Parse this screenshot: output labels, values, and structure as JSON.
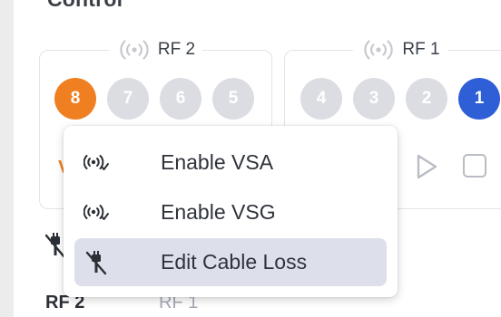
{
  "section": {
    "title": "Control"
  },
  "rf_groups": [
    {
      "title": "RF 2",
      "icon": "wireless-signal-icon",
      "ports": [
        {
          "label": "8",
          "state": "active",
          "color": "#f07f22"
        },
        {
          "label": "7",
          "state": "inactive"
        },
        {
          "label": "6",
          "state": "inactive"
        },
        {
          "label": "5",
          "state": "inactive"
        }
      ],
      "mode_label": "VS"
    },
    {
      "title": "RF 1",
      "icon": "wireless-signal-icon",
      "ports": [
        {
          "label": "4",
          "state": "inactive"
        },
        {
          "label": "3",
          "state": "inactive"
        },
        {
          "label": "2",
          "state": "inactive"
        },
        {
          "label": "1",
          "state": "active",
          "color": "#2f5fd6"
        }
      ]
    }
  ],
  "context_menu": {
    "items": [
      {
        "label": "Enable VSA",
        "icon": "wireless-signal-icon",
        "highlighted": false
      },
      {
        "label": "Enable VSG",
        "icon": "wireless-signal-icon",
        "highlighted": false
      },
      {
        "label": "Edit Cable Loss",
        "icon": "cable-off-icon",
        "highlighted": true
      }
    ]
  },
  "bottom": {
    "rf2_label": "RF 2",
    "rf1_label": "RF 1"
  },
  "colors": {
    "accent_orange": "#f07f22",
    "accent_blue": "#2f5fd6",
    "menu_highlight": "#dde0ea"
  }
}
